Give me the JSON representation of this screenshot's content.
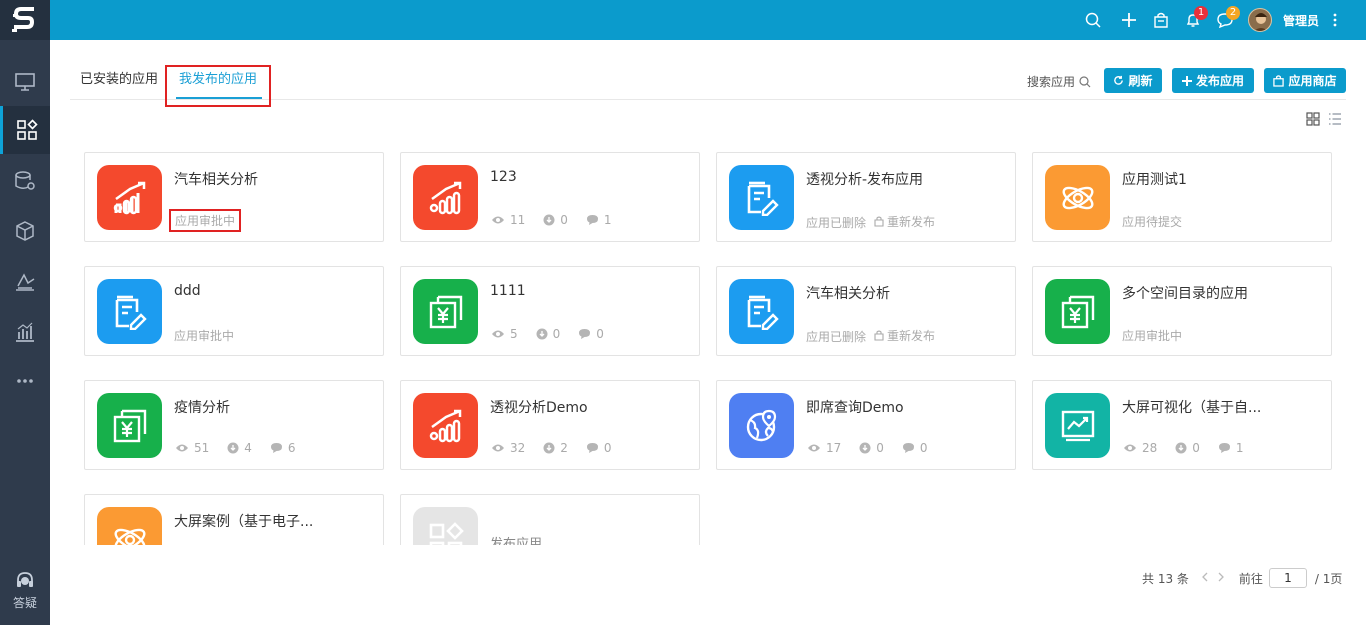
{
  "sidebar": {
    "logo": "S",
    "help_label": "答疑"
  },
  "topbar": {
    "notifications_badge": "1",
    "messages_badge": "2",
    "user_name": "管理员"
  },
  "tabs": {
    "installed": "已安装的应用",
    "published": "我发布的应用"
  },
  "toolbar": {
    "search_label": "搜索应用",
    "refresh": "刷新",
    "publish": "发布应用",
    "store": "应用商店"
  },
  "cards": [
    {
      "title": "汽车相关分析",
      "status": "应用审批中",
      "color": "#f4492d"
    },
    {
      "title": "123",
      "views": "11",
      "downloads": "0",
      "comments": "1",
      "color": "#f4492d"
    },
    {
      "title": "透视分析-发布应用",
      "status": "应用已删除",
      "republish": "重新发布",
      "color": "#1c9cf0"
    },
    {
      "title": "应用测试1",
      "status": "应用待提交",
      "color": "#fb9a33"
    },
    {
      "title": "ddd",
      "status": "应用审批中",
      "color": "#1c9cf0"
    },
    {
      "title": "1111",
      "views": "5",
      "downloads": "0",
      "comments": "0",
      "color": "#17b04b"
    },
    {
      "title": "汽车相关分析",
      "status": "应用已删除",
      "republish": "重新发布",
      "color": "#1c9cf0"
    },
    {
      "title": "多个空间目录的应用",
      "status": "应用审批中",
      "color": "#17b04b"
    },
    {
      "title": "疫情分析",
      "views": "51",
      "downloads": "4",
      "comments": "6",
      "color": "#17b04b"
    },
    {
      "title": "透视分析Demo",
      "views": "32",
      "downloads": "2",
      "comments": "0",
      "color": "#f4492d"
    },
    {
      "title": "即席查询Demo",
      "views": "17",
      "downloads": "0",
      "comments": "0",
      "color": "#4f7ff2"
    },
    {
      "title": "大屏可视化（基于自...",
      "views": "28",
      "downloads": "0",
      "comments": "1",
      "color": "#12b4a5"
    },
    {
      "title": "大屏案例（基于电子...",
      "color": "#fb9a33"
    },
    {
      "title": "发布应用"
    }
  ],
  "pagination": {
    "total": "共 13 条",
    "goto": "前往",
    "page": "1",
    "pages": "/ 1页"
  }
}
